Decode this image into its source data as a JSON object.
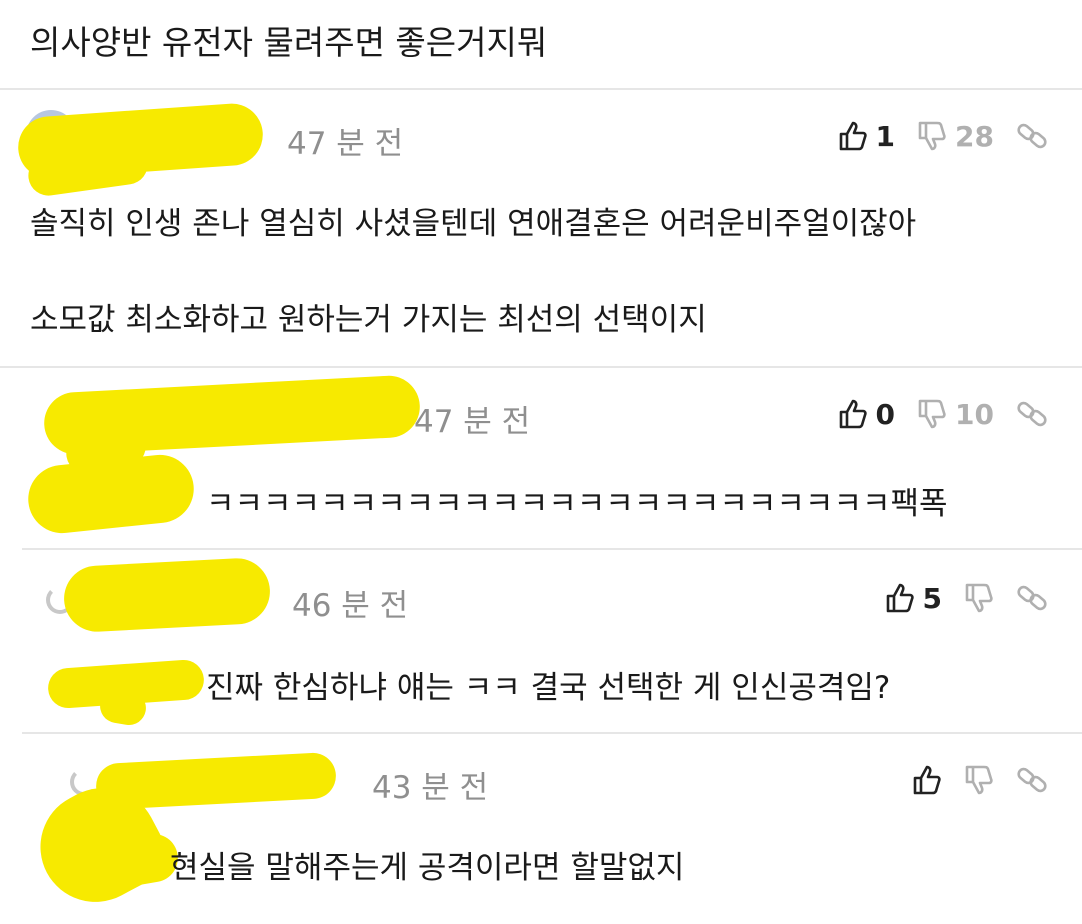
{
  "post": {
    "title": "의사양반 유전자 물려주면 좋은거지뭐"
  },
  "comments": [
    {
      "time": "47 분 전",
      "likes": "1",
      "dislikes": "28",
      "lines": [
        "솔직히 인생 존나 열심히 사셨을텐데 연애결혼은 어려운비주얼이잖아",
        "소모값 최소화하고 원하는거 가지는 최선의 선택이지"
      ]
    },
    {
      "time": "47 분 전",
      "likes": "0",
      "dislikes": "10",
      "lines": [
        "ㅋㅋㅋㅋㅋㅋㅋㅋㅋㅋㅋㅋㅋㅋㅋㅋㅋㅋㅋㅋㅋㅋㅋㅋ팩폭"
      ]
    },
    {
      "time": "46 분 전",
      "likes": "5",
      "dislikes": "",
      "lines": [
        "진짜 한심하냐 얘는 ㅋㅋ 결국 선택한 게 인신공격임?"
      ]
    },
    {
      "time": "43 분 전",
      "likes": "",
      "dislikes": "",
      "lines": [
        "현실을 말해주는게 공격이라면 할말없지"
      ]
    }
  ],
  "icons": {
    "like": "thumbs-up-icon",
    "dislike": "thumbs-down-icon",
    "link": "link-icon"
  },
  "colors": {
    "redaction": "#f7ea00",
    "muted": "#8f8f8f",
    "divider": "#e6e6e6"
  }
}
